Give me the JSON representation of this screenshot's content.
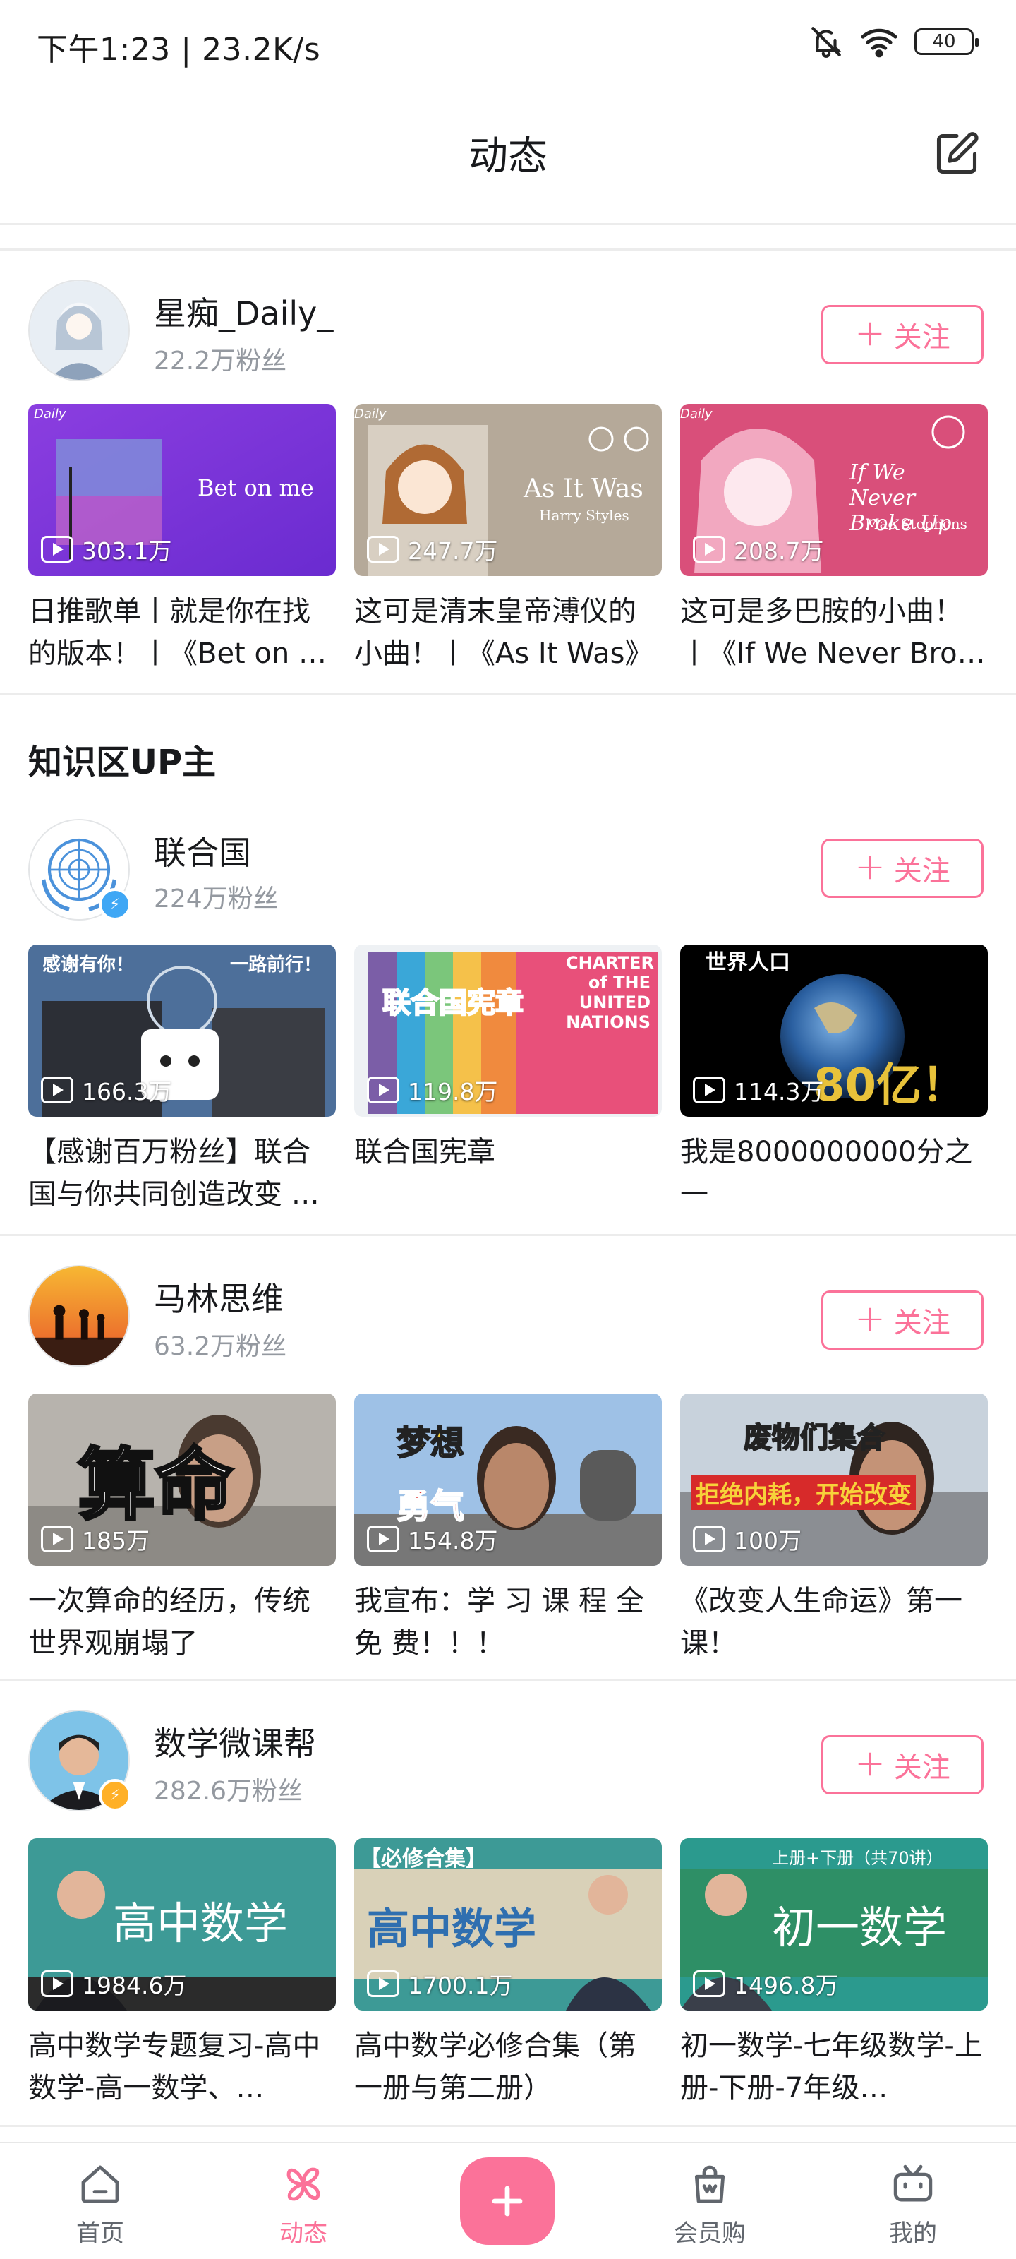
{
  "status_bar": {
    "text": "下午1:23 | 23.2K/s",
    "battery": "40"
  },
  "header": {
    "title": "动态"
  },
  "colors": {
    "accent": "#fb7299",
    "verify_blue": "#3fa7f5",
    "verify_orange": "#ffb027"
  },
  "follow_label": "关注",
  "section_title": "知识区UP主",
  "ups": [
    {
      "name": "星痴_Daily_",
      "fans": "22.2万粉丝",
      "avatar_icon": "anime-girl-avatar",
      "verified": "",
      "videos": [
        {
          "plays": "303.1万",
          "title": "日推歌单丨就是你在找的版本！丨《Bet on …",
          "thumb_text": "Bet on me",
          "corner": "Daily"
        },
        {
          "plays": "247.7万",
          "title": "这可是清末皇帝溥仪的小曲！丨《As It Was》",
          "thumb_text": "As It Was",
          "thumb_sub": "Harry Styles",
          "corner": "Daily"
        },
        {
          "plays": "208.7万",
          "title": "这可是多巴胺的小曲！丨《If We Never Bro…",
          "thumb_text": "If We Never Broke Up",
          "thumb_sub": "Mae Stephens",
          "corner": "Daily"
        }
      ]
    },
    {
      "name": "联合国",
      "fans": "224万粉丝",
      "avatar_icon": "un-emblem-avatar",
      "verified": "blue",
      "videos": [
        {
          "plays": "166.3万",
          "title": "【感谢百万粉丝】联合国与你共同创造改变 …",
          "thumb_text": "感谢有你！",
          "thumb_sub": "一路前行！"
        },
        {
          "plays": "119.8万",
          "title": "联合国宪章",
          "thumb_text": "联合国宪章",
          "thumb_sub": "CHARTER of THE UNITED NATIONS"
        },
        {
          "plays": "114.3万",
          "title": "我是8000000000分之一",
          "thumb_text": "世界人口",
          "thumb_sub": "80亿！"
        }
      ]
    },
    {
      "name": "马林思维",
      "fans": "63.2万粉丝",
      "avatar_icon": "sunset-silhouette-avatar",
      "verified": "",
      "videos": [
        {
          "plays": "185万",
          "title": "一次算命的经历，传统世界观崩塌了",
          "thumb_text": "算命"
        },
        {
          "plays": "154.8万",
          "title": "我宣布：学 习 课 程 全 免 费！！！",
          "thumb_text": "梦想",
          "thumb_sub": "勇气"
        },
        {
          "plays": "100万",
          "title": "《改变人生命运》第一课！",
          "thumb_text": "废物们集合",
          "thumb_sub": "拒绝内耗，开始改变"
        }
      ]
    },
    {
      "name": "数学微课帮",
      "fans": "282.6万粉丝",
      "avatar_icon": "teacher-portrait-avatar",
      "verified": "orange",
      "videos": [
        {
          "plays": "1984.6万",
          "title": "高中数学专题复习-高中数学-高一数学、…",
          "thumb_text": "高中数学"
        },
        {
          "plays": "1700.1万",
          "title": "高中数学必修合集（第一册与第二册）",
          "thumb_text": "高中数学",
          "thumb_sub": "【必修合集】"
        },
        {
          "plays": "1496.8万",
          "title": "初一数学-七年级数学-上册-下册-7年级…",
          "thumb_text": "初一数学",
          "thumb_sub": "上册+下册（共70讲）"
        }
      ]
    }
  ],
  "bottom_nav": [
    {
      "label": "首页",
      "icon": "home-icon"
    },
    {
      "label": "动态",
      "icon": "pinwheel-icon",
      "active": true
    },
    {
      "label": "",
      "icon": "plus-icon"
    },
    {
      "label": "会员购",
      "icon": "shopping-bag-icon"
    },
    {
      "label": "我的",
      "icon": "tv-face-icon"
    }
  ]
}
